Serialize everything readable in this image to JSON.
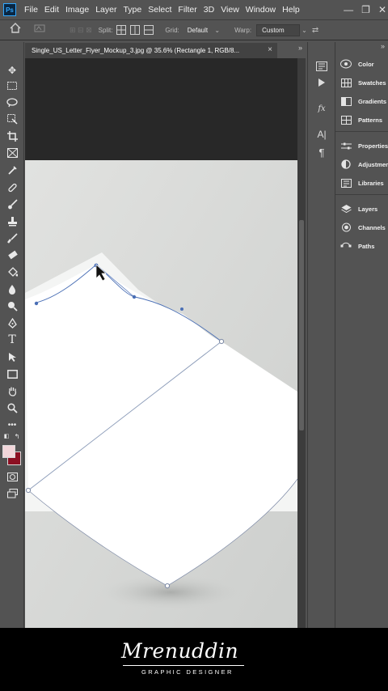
{
  "app": {
    "logo_text": "Ps"
  },
  "menu": [
    "File",
    "Edit",
    "Image",
    "Layer",
    "Type",
    "Select",
    "Filter",
    "3D",
    "View",
    "Window",
    "Help"
  ],
  "window_controls": [
    "—",
    "❐",
    "✕"
  ],
  "options_bar": {
    "split_label": "Split:",
    "grid_label": "Grid:",
    "grid_value": "Default",
    "warp_label": "Warp:",
    "warp_value": "Custom"
  },
  "document": {
    "tab_title": "Single_US_Letter_Flyer_Mockup_3.jpg @ 35.6% (Rectangle 1, RGB/8...",
    "close_glyph": "×"
  },
  "panels": [
    {
      "label": "Color",
      "icon": "color-wheel-icon"
    },
    {
      "label": "Swatches",
      "icon": "swatches-grid-icon"
    },
    {
      "label": "Gradients",
      "icon": "gradient-icon"
    },
    {
      "label": "Patterns",
      "icon": "patterns-grid-icon"
    },
    {
      "label": "Properties",
      "icon": "properties-sliders-icon"
    },
    {
      "label": "Adjustments",
      "icon": "adjustments-circle-icon"
    },
    {
      "label": "Libraries",
      "icon": "libraries-icon"
    },
    {
      "label": "Layers",
      "icon": "layers-stack-icon"
    },
    {
      "label": "Channels",
      "icon": "channels-icon"
    },
    {
      "label": "Paths",
      "icon": "paths-icon"
    }
  ],
  "colors": {
    "foreground": "#f2d6da",
    "background": "#8c0f22",
    "ps_blue": "#31a8ff",
    "warp_handle": "#4a6fb5"
  },
  "brand": {
    "script": "Mrenuddin",
    "tagline": "GRAPHIC DESIGNER"
  }
}
